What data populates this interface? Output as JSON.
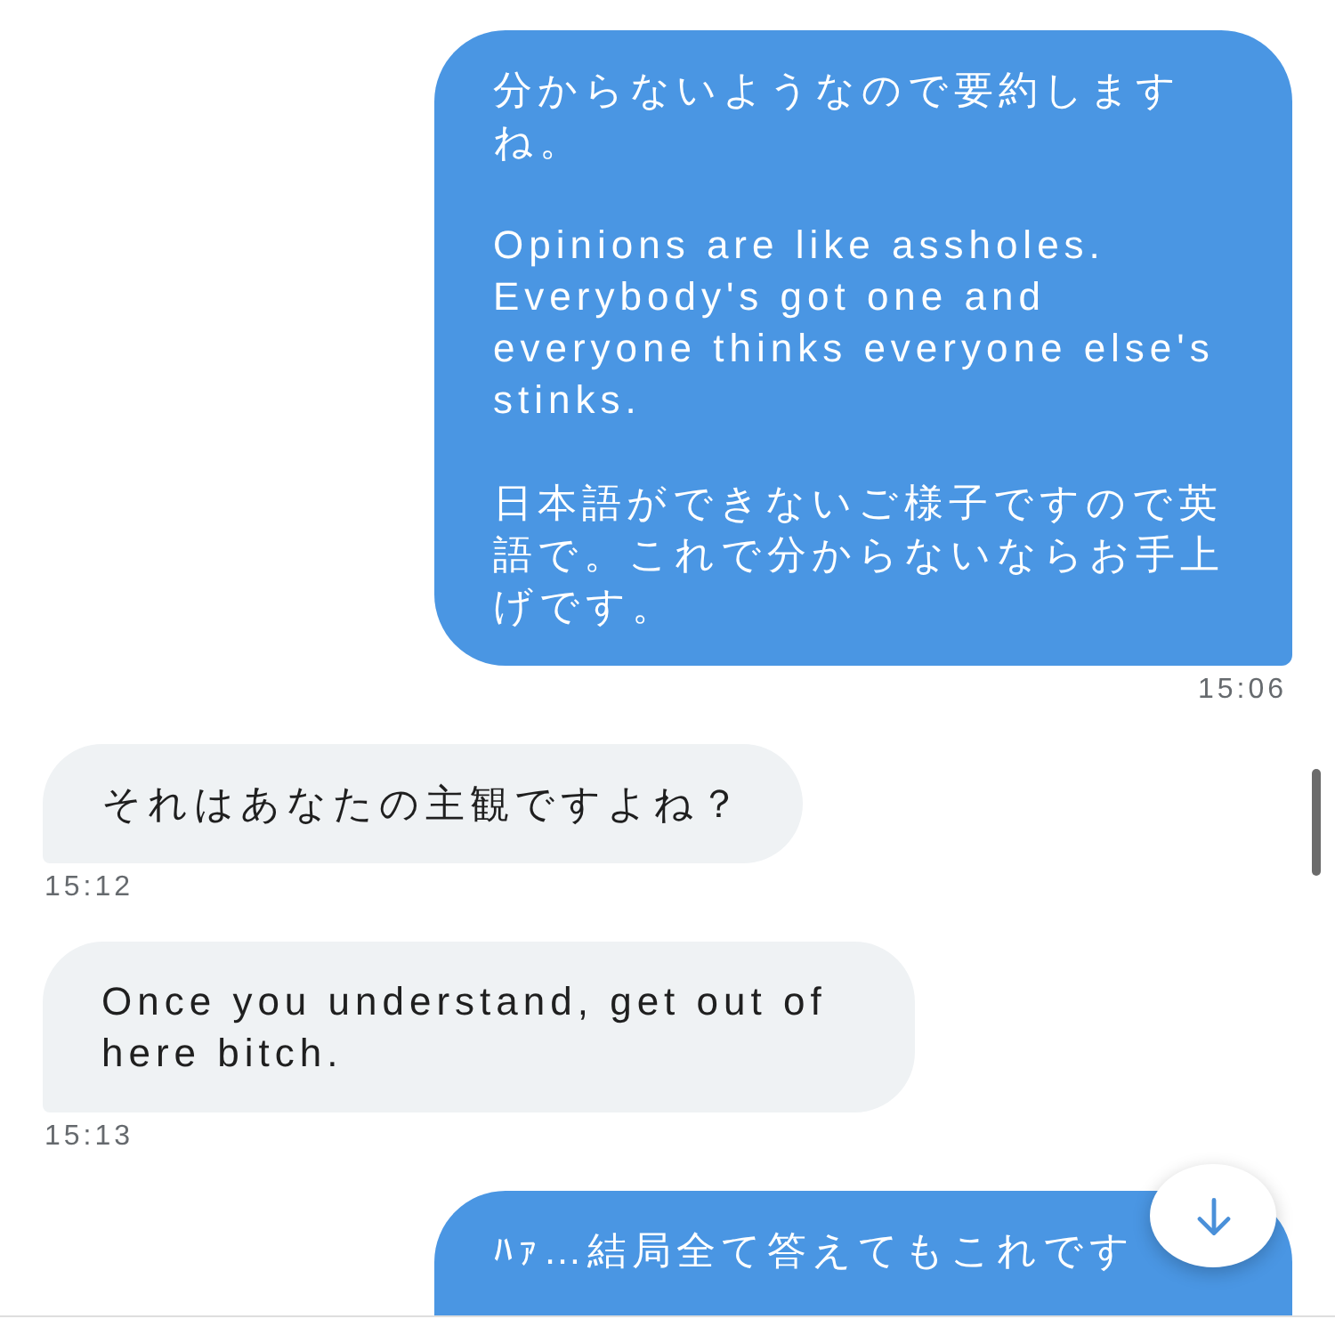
{
  "messages": [
    {
      "kind": "sent",
      "text": "分からないようなので要約しますね。\n\nOpinions are like assholes. Everybody's got one and everyone thinks everyone else's stinks.\n\n日本語ができないご様子ですので英語で。これで分からないならお手上げです。",
      "time": "15:06"
    },
    {
      "kind": "received",
      "text": "それはあなたの主観ですよね？",
      "time": "15:12"
    },
    {
      "kind": "received",
      "text": "Once you understand, get out of here bitch.",
      "time": "15:13"
    },
    {
      "kind": "sent",
      "text": "ﾊｧ…結局全て答えてもこれです",
      "truncated": true
    }
  ]
}
